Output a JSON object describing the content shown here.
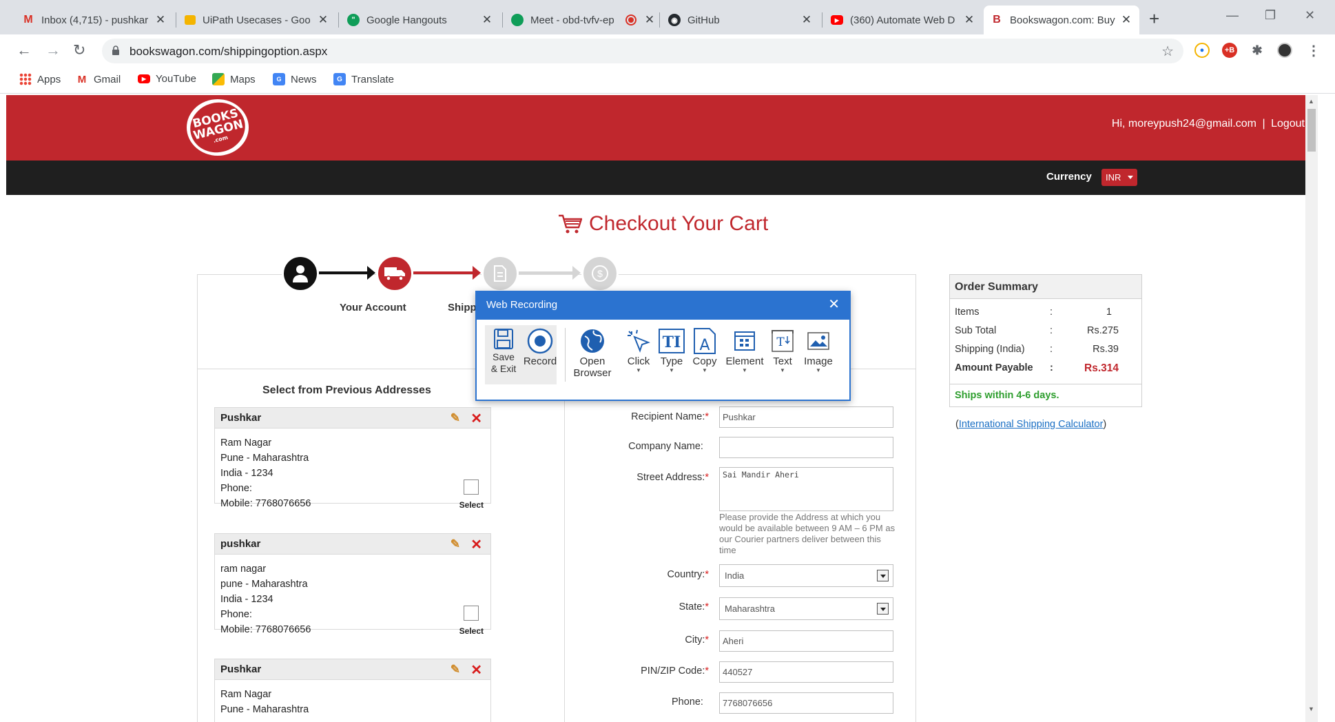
{
  "browser": {
    "tabs": [
      {
        "title": "Inbox (4,715) - pushkar",
        "icon": "gmail-icon"
      },
      {
        "title": "UiPath Usecases - Goo",
        "icon": "slides-icon"
      },
      {
        "title": "Google Hangouts",
        "icon": "hangouts-icon"
      },
      {
        "title": "Meet - obd-tvfv-ep",
        "icon": "meet-icon"
      },
      {
        "title": "GitHub",
        "icon": "github-icon"
      },
      {
        "title": "(360) Automate Web D",
        "icon": "youtube-icon"
      },
      {
        "title": "Bookswagon.com: Buy",
        "icon": "bookswagon-icon"
      }
    ],
    "url": "bookswagon.com/shippingoption.aspx",
    "bookmarks": [
      {
        "label": "Apps",
        "icon": "apps-grid-icon"
      },
      {
        "label": "Gmail",
        "icon": "gmail-icon"
      },
      {
        "label": "YouTube",
        "icon": "youtube-icon"
      },
      {
        "label": "Maps",
        "icon": "maps-icon"
      },
      {
        "label": "News",
        "icon": "news-icon"
      },
      {
        "label": "Translate",
        "icon": "translate-icon"
      }
    ]
  },
  "site": {
    "logo_text": "BOOKS WAGON .com",
    "greeting": "Hi, moreypush24@gmail.com",
    "separator": "|",
    "logout": "Logout",
    "currency_label": "Currency",
    "currency_value": "INR",
    "checkout_title": "Checkout Your Cart",
    "steps": [
      {
        "label": "Your Account",
        "state": "done"
      },
      {
        "label": "Shipping",
        "state": "current"
      },
      {
        "label": "",
        "state": "pending"
      },
      {
        "label": "",
        "state": "pending"
      }
    ],
    "prev_title": "Select from Previous Addresses",
    "addresses": [
      {
        "name": "Pushkar",
        "line1": "Ram Nagar",
        "line2": "Pune - Maharashtra",
        "line3": "India - 1234",
        "phone": "Phone:",
        "mobile": "Mobile: 7768076656",
        "select": "Select"
      },
      {
        "name": "pushkar",
        "line1": "ram nagar",
        "line2": "pune - Maharashtra",
        "line3": "India - 1234",
        "phone": "Phone:",
        "mobile": "Mobile: 7768076656",
        "select": "Select"
      },
      {
        "name": "Pushkar",
        "line1": "Ram Nagar",
        "line2": "Pune - Maharashtra",
        "line3": "",
        "phone": "",
        "mobile": "",
        "select": ""
      }
    ],
    "form": {
      "recipient_label": "Recipient Name:",
      "recipient_value": "Pushkar",
      "company_label": "Company Name:",
      "company_value": "",
      "street_label": "Street Address:",
      "street_value": "Sai Mandir Aheri",
      "street_hint": "Please provide the Address at which you would be available between 9 AM – 6 PM as our Courier partners deliver between this time",
      "country_label": "Country:",
      "country_value": "India",
      "state_label": "State:",
      "state_value": "Maharashtra",
      "city_label": "City:",
      "city_value": "Aheri",
      "pin_label": "PIN/ZIP Code:",
      "pin_value": "440527",
      "phone_label": "Phone:",
      "phone_value": "7768076656"
    },
    "summary": {
      "title": "Order Summary",
      "rows": [
        {
          "label": "Items",
          "sep": ":",
          "value": "1"
        },
        {
          "label": "Sub Total",
          "sep": ":",
          "value": "Rs.275"
        },
        {
          "label": "Shipping (India)",
          "sep": ":",
          "value": "Rs.39"
        },
        {
          "label": "Amount Payable",
          "sep": ":",
          "value": "Rs.314"
        }
      ],
      "ships": "Ships within 4-6 days.",
      "intl_open": "(",
      "intl_link": "International Shipping Calculator",
      "intl_close": ")"
    }
  },
  "recorder": {
    "title": "Web Recording",
    "tools": [
      {
        "label": "Save\n& Exit",
        "icon": "save-icon"
      },
      {
        "label": "Record",
        "icon": "record-icon"
      },
      {
        "label": "Open\nBrowser",
        "icon": "globe-icon"
      },
      {
        "label": "Click",
        "icon": "click-icon"
      },
      {
        "label": "Type",
        "icon": "type-icon"
      },
      {
        "label": "Copy",
        "icon": "copy-icon"
      },
      {
        "label": "Element",
        "icon": "element-icon"
      },
      {
        "label": "Text",
        "icon": "text-icon"
      },
      {
        "label": "Image",
        "icon": "image-icon"
      }
    ]
  },
  "colors": {
    "brand_red": "#c0272d",
    "recorder_blue": "#2b73d0",
    "ships_green": "#2e9e2e"
  }
}
